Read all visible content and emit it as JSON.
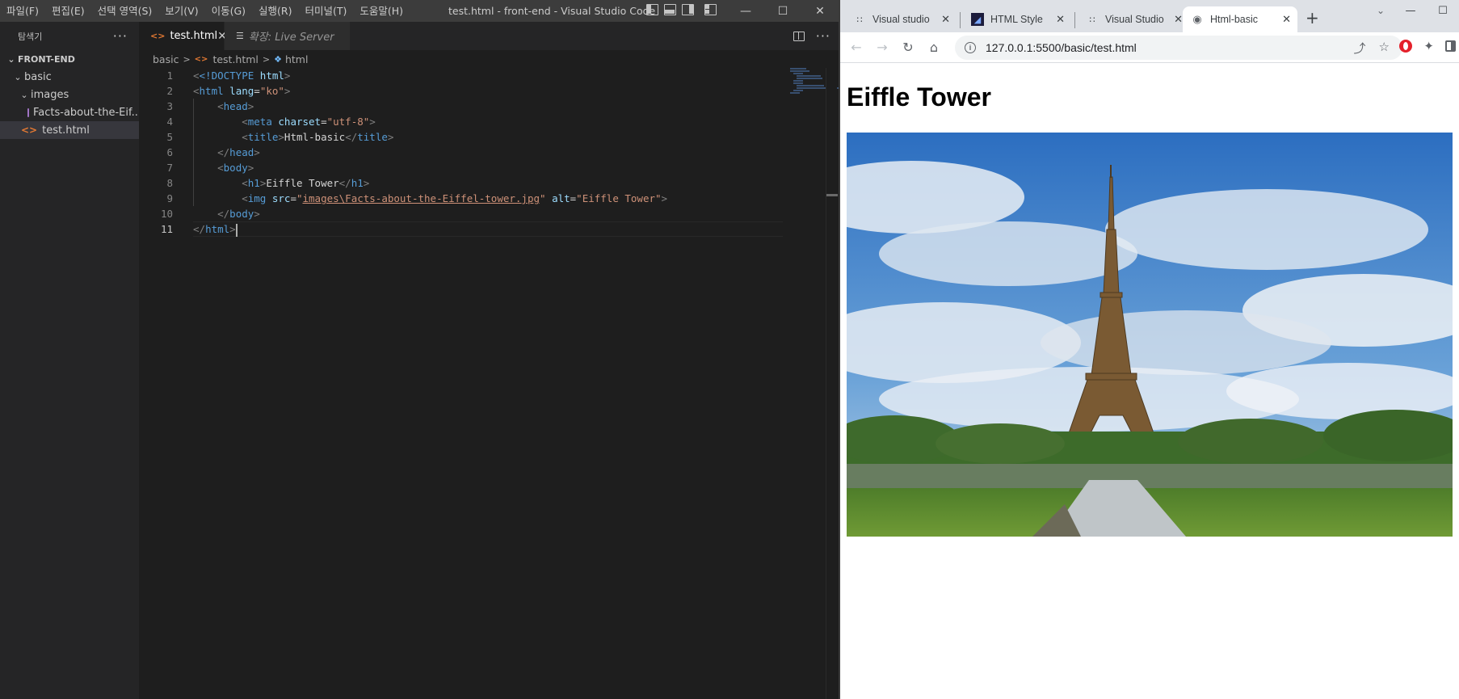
{
  "vscode": {
    "menus": [
      "파일(F)",
      "편집(E)",
      "선택 영역(S)",
      "보기(V)",
      "이동(G)",
      "실행(R)",
      "터미널(T)",
      "도움말(H)"
    ],
    "window_title": "test.html - front-end - Visual Studio Code",
    "explorer": {
      "title": "탐색기",
      "root": "FRONT-END",
      "folder_basic": "basic",
      "folder_images": "images",
      "file_image": "Facts-about-the-Eif...",
      "file_html": "test.html"
    },
    "tabs": {
      "active": "test.html",
      "preview": "확장: Live Server"
    },
    "breadcrumb": {
      "folder": "basic",
      "file": "test.html",
      "symbol": "html"
    },
    "line_numbers": [
      "1",
      "2",
      "3",
      "4",
      "5",
      "6",
      "7",
      "8",
      "9",
      "10",
      "11"
    ],
    "code": {
      "l1_doctype": "<!DOCTYPE",
      "l1_html": "html",
      "l2_tag": "html",
      "l2_attr": "lang",
      "l2_val": "\"ko\"",
      "l3_tag": "head",
      "l4_tag": "meta",
      "l4_attr": "charset",
      "l4_val": "\"utf-8\"",
      "l5_tag": "title",
      "l5_text": "Html-basic",
      "l6_tag": "head",
      "l7_tag": "body",
      "l8_tag": "h1",
      "l8_text": "Eiffle Tower",
      "l9_tag": "img",
      "l9_attr_src": "src",
      "l9_src_val": "images\\Facts-about-the-Eiffel-tower.jpg",
      "l9_attr_alt": "alt",
      "l9_alt_val": "\"Eiffle Tower\"",
      "l10_tag": "body",
      "l11_tag": "html"
    }
  },
  "chrome": {
    "tabs": [
      "Visual studio",
      "HTML Style ",
      "Visual Studio",
      "Html-basic"
    ],
    "url": "127.0.0.1:5500/basic/test.html",
    "page_heading": "Eiffle Tower"
  },
  "colors": {
    "vscode_bg": "#1e1e1e",
    "tag": "#569cd6",
    "attr": "#9cdcfe",
    "string": "#ce9178",
    "chrome_tabstrip": "#dee1e6"
  }
}
